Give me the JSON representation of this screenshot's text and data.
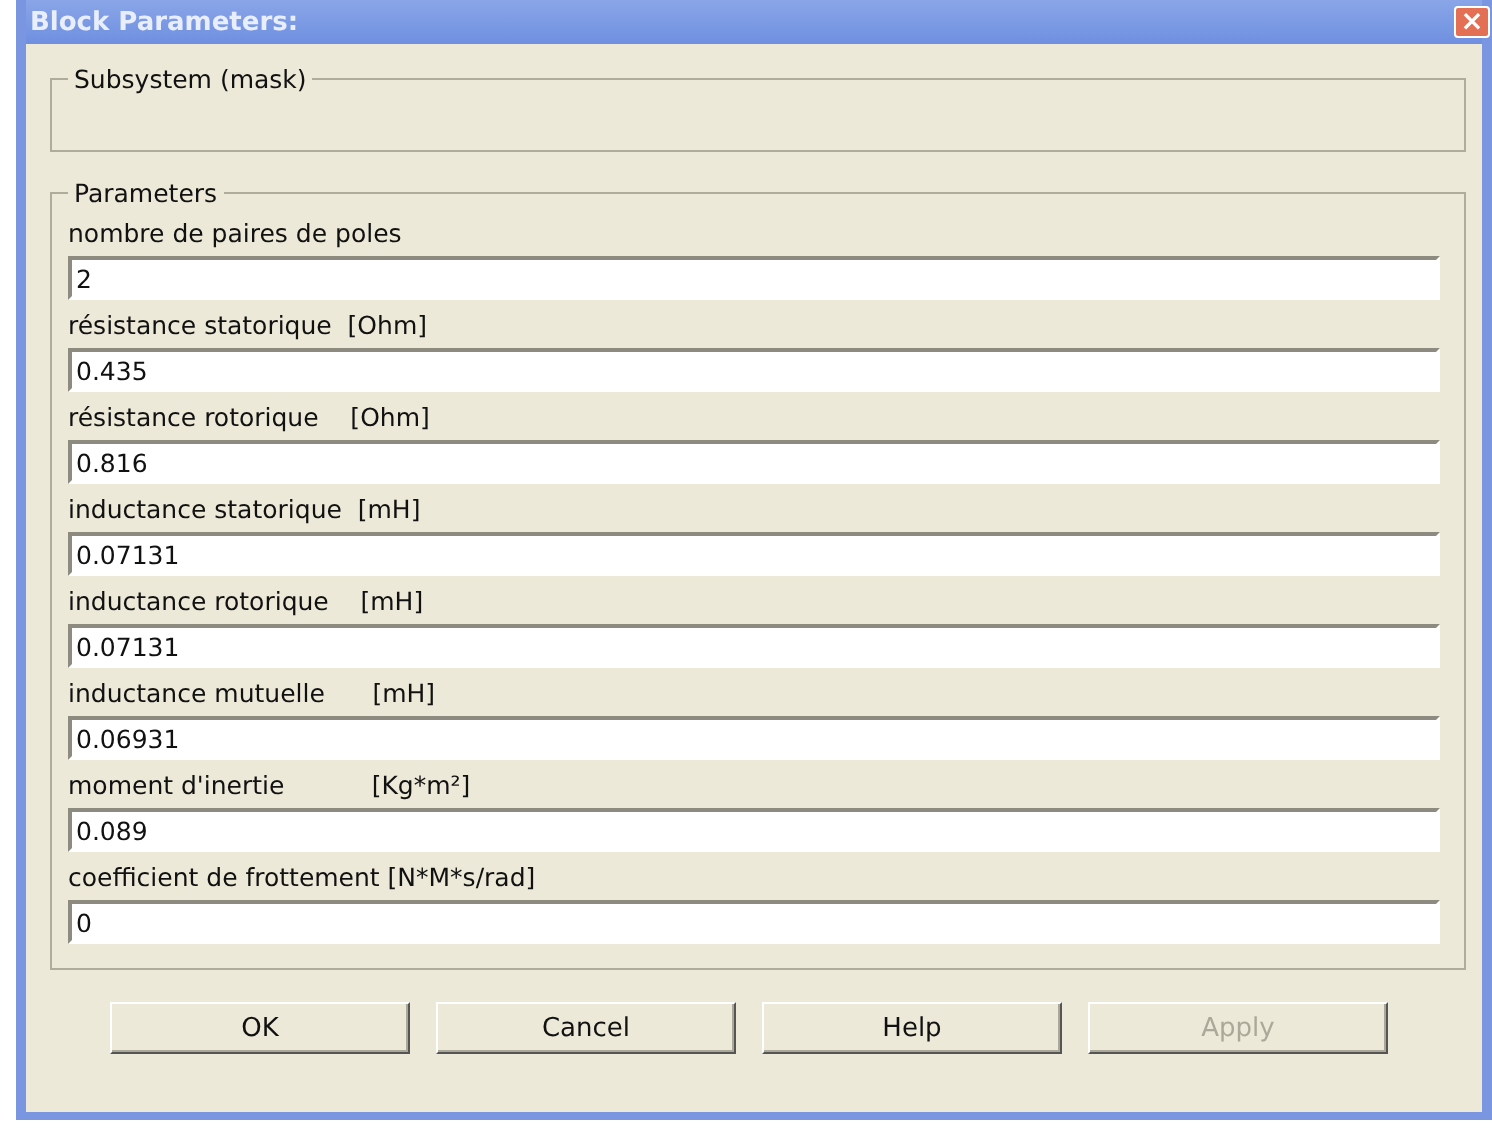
{
  "window": {
    "title": "Block Parameters:",
    "close": "×"
  },
  "description_group": {
    "title": "Subsystem (mask)"
  },
  "parameters_group": {
    "title": "Parameters",
    "fields": [
      {
        "label": "nombre de paires de poles",
        "value": "2"
      },
      {
        "label": "résistance statorique  [Ohm]",
        "value": "0.435"
      },
      {
        "label": "résistance rotorique    [Ohm]",
        "value": "0.816"
      },
      {
        "label": "inductance statorique  [mH]",
        "value": "0.07131"
      },
      {
        "label": "inductance rotorique    [mH]",
        "value": "0.07131"
      },
      {
        "label": "inductance mutuelle      [mH]",
        "value": "0.06931"
      },
      {
        "label": "moment d'inertie           [Kg*m²]",
        "value": "0.089"
      },
      {
        "label": "coefficient de frottement [N*M*s/rad]",
        "value": "0"
      }
    ]
  },
  "buttons": [
    {
      "label": "OK",
      "disabled": false
    },
    {
      "label": "Cancel",
      "disabled": false
    },
    {
      "label": "Help",
      "disabled": false
    },
    {
      "label": "Apply",
      "disabled": true
    }
  ]
}
